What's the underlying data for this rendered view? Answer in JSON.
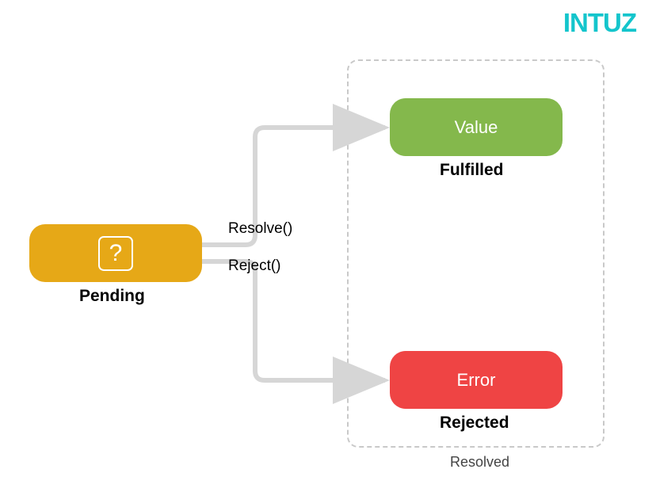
{
  "brand": {
    "name": "INTUZ"
  },
  "nodes": {
    "pending": {
      "icon": "?",
      "label": "Pending"
    },
    "value": {
      "text": "Value",
      "label": "Fulfilled"
    },
    "error": {
      "text": "Error",
      "label": "Rejected"
    }
  },
  "edges": {
    "resolve": "Resolve()",
    "reject": "Reject()"
  },
  "group": {
    "label": "Resolved"
  },
  "colors": {
    "pending": "#e6a817",
    "value": "#84b84c",
    "error": "#ef4444",
    "arrow": "#d6d6d6",
    "brand": "#14c5cc"
  }
}
